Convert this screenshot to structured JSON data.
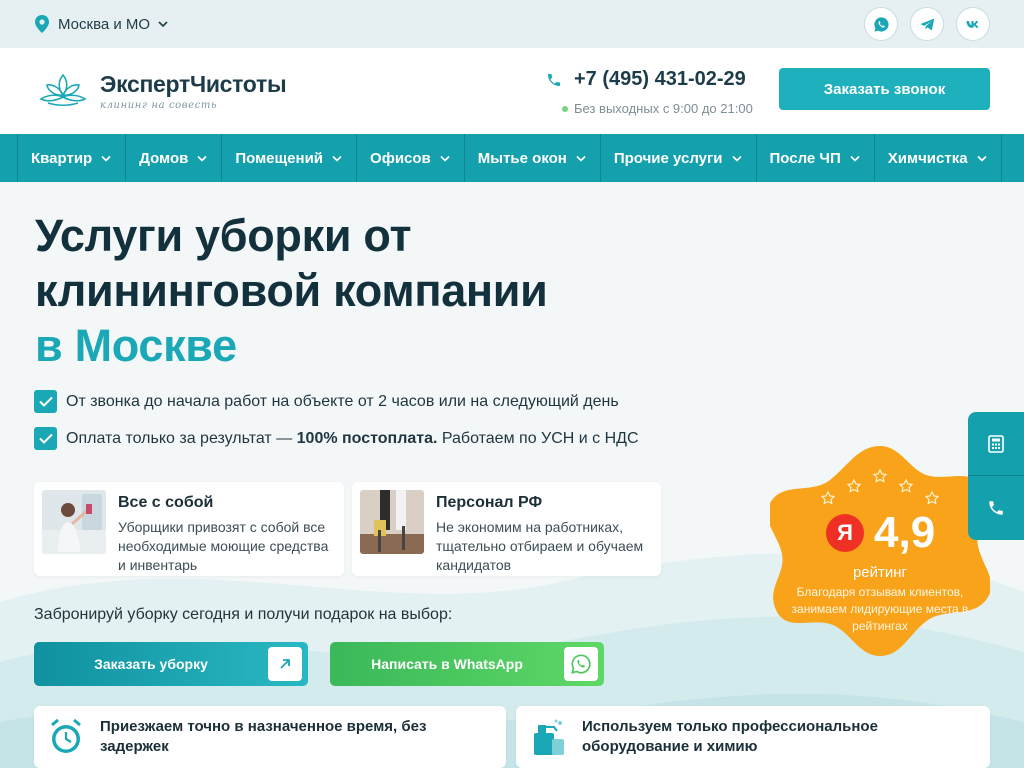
{
  "topbar": {
    "city": "Москва и МО"
  },
  "brand": {
    "name": "ЭкспертЧистоты",
    "tagline": "клининг на совесть"
  },
  "contact": {
    "phone": "+7 (495) 431-02-29",
    "hours": "Без выходных с 9:00 до 21:00",
    "callback_label": "Заказать звонок"
  },
  "nav": [
    "Квартир",
    "Домов",
    "Помещений",
    "Офисов",
    "Мытье окон",
    "Прочие услуги",
    "После ЧП",
    "Химчистка"
  ],
  "hero": {
    "title_line1": "Услуги уборки от",
    "title_line2": "клининговой компании",
    "title_accent": "в Москве",
    "check1": "От звонка до начала работ на объекте от 2 часов или на следующий день",
    "check2_a": "Оплата только за результат — ",
    "check2_b": "100% постоплата.",
    "check2_c": " Работаем по УСН и с НДС"
  },
  "features": [
    {
      "title": "Все с собой",
      "desc": "Уборщики привозят с собой все необходимые моющие средства и инвентарь"
    },
    {
      "title": "Персонал РФ",
      "desc": "Не экономим на работниках, тщательно отбираем и обучаем кандидатов"
    }
  ],
  "cta": {
    "gift_text": "Забронируй уборку сегодня и получи подарок на выбор:",
    "order_label": "Заказать уборку",
    "whatsapp_label": "Написать в WhatsApp"
  },
  "rating": {
    "logo_letter": "Я",
    "score": "4,9",
    "label": "рейтинг",
    "desc": "Благодаря отзывам клиентов, занимаем лидирующие места в рейтингах"
  },
  "perks": [
    {
      "text": "Приезжаем точно в назначенное время, без задержек"
    },
    {
      "text": "Используем только профессиональное оборудование и химию"
    }
  ],
  "colors": {
    "teal": "#15a0ae",
    "accent": "#1aa8b6",
    "orange": "#f9a31b",
    "whatsapp": "#4cc85e"
  }
}
